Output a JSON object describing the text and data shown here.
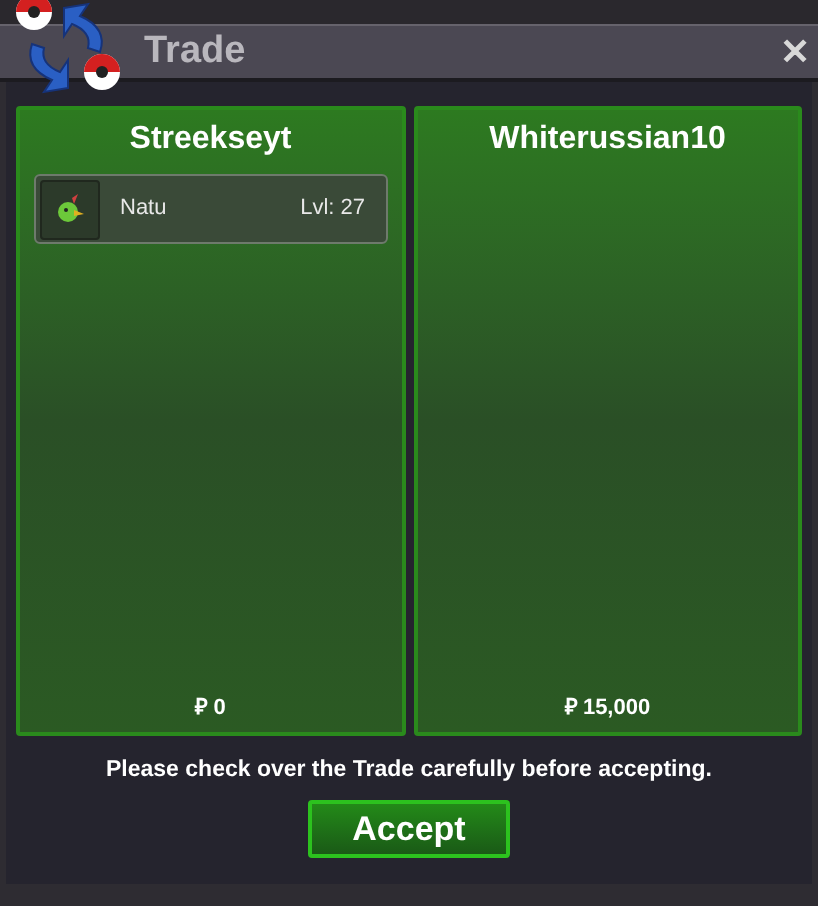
{
  "window": {
    "title": "Trade",
    "close": "✕"
  },
  "panels": [
    {
      "player": "Streekseyt",
      "items": [
        {
          "name": "Natu",
          "level": "Lvl: 27"
        }
      ],
      "money": "₽ 0"
    },
    {
      "player": "Whiterussian10",
      "money": "₽ 15,000"
    }
  ],
  "notice": "Please check over the Trade carefully before accepting.",
  "accept_button": "Accept"
}
